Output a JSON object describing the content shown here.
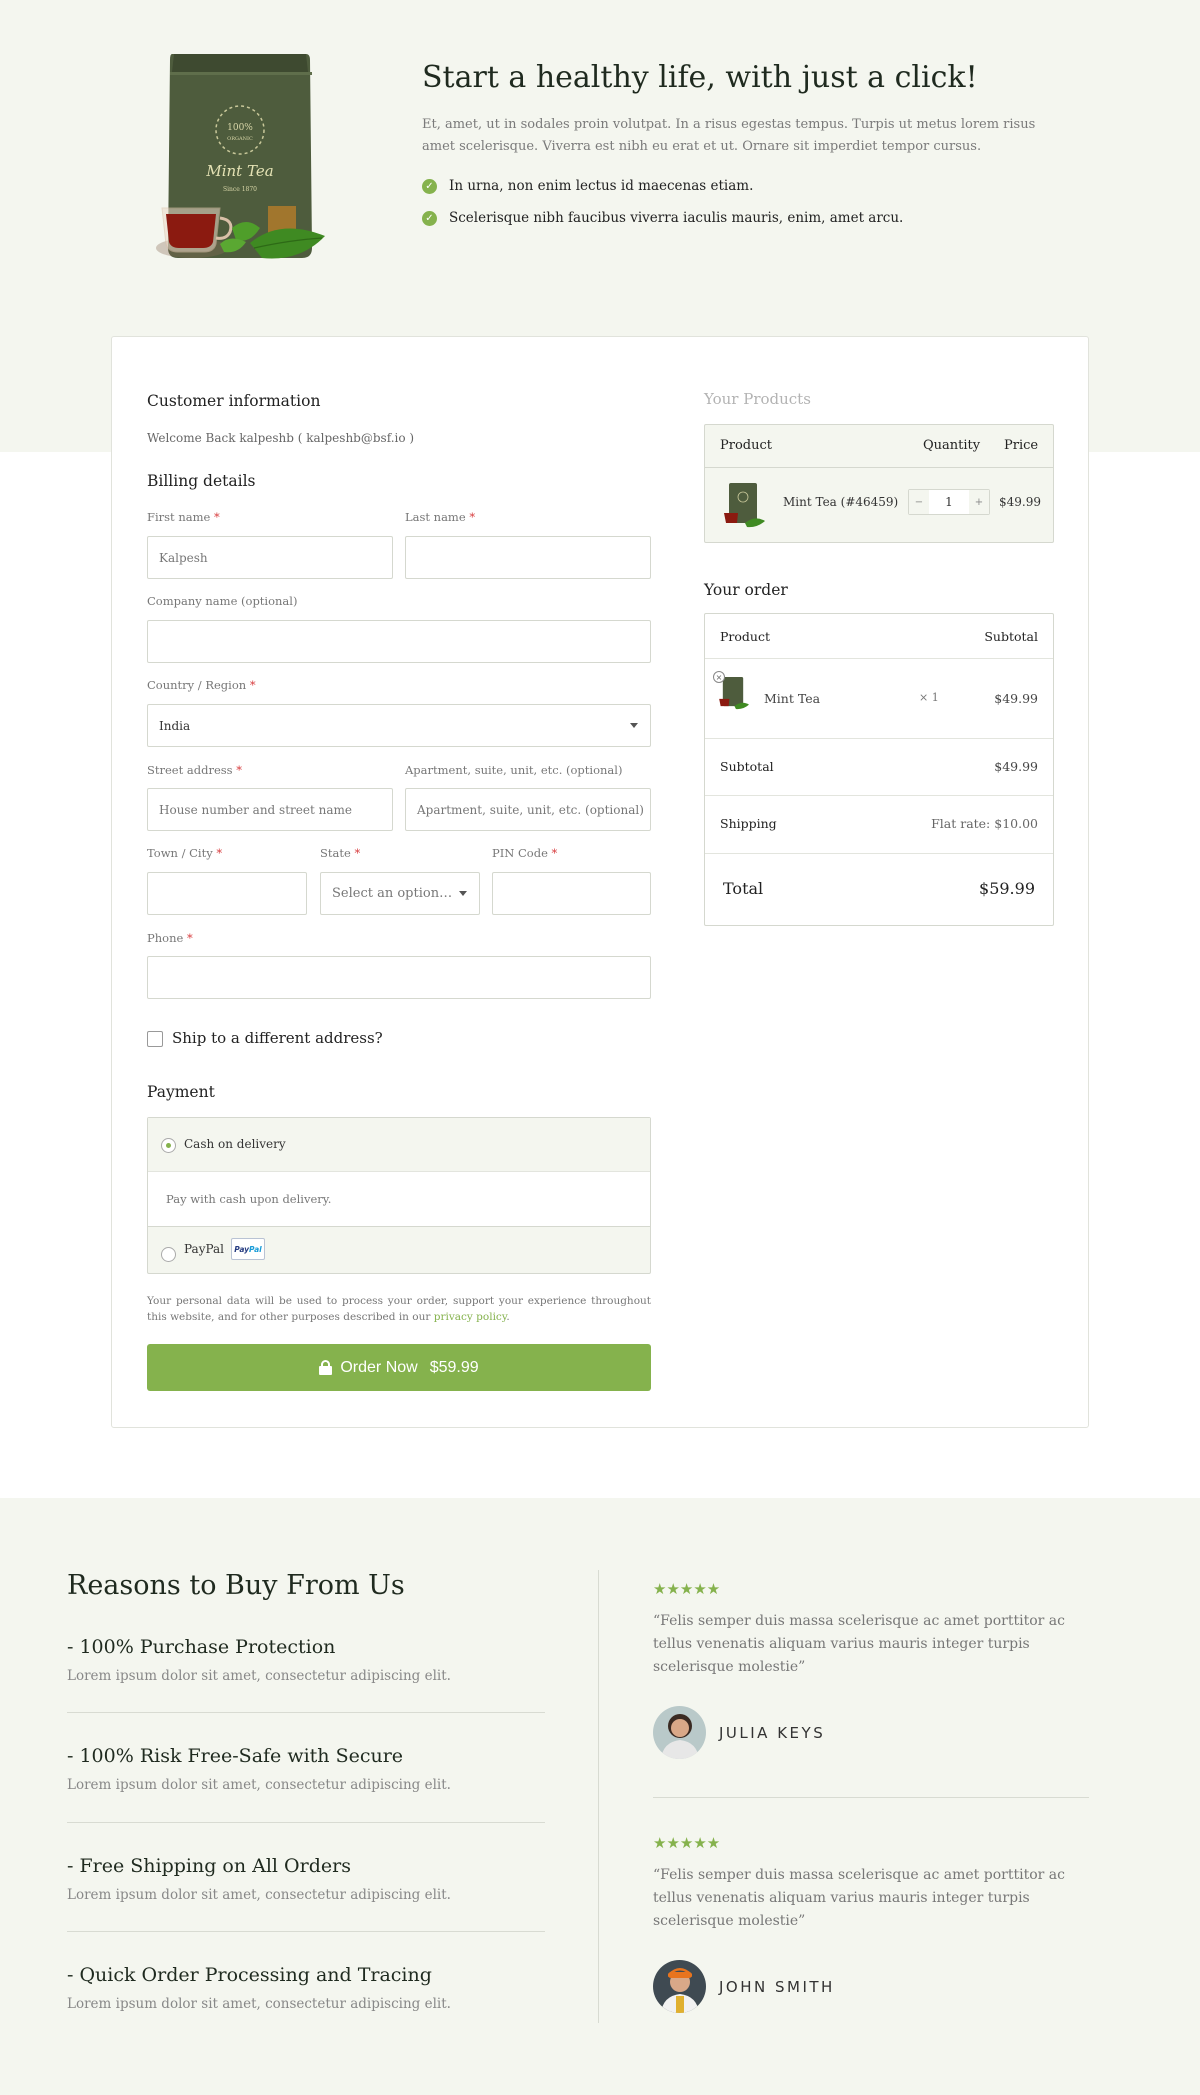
{
  "hero": {
    "title": "Start a healthy life, with just a click!",
    "description": "Et, amet, ut in sodales proin volutpat. In a risus egestas tempus. Turpis ut metus lorem risus amet scelerisque. Viverra est nibh eu erat et ut. Ornare sit imperdiet tempor cursus.",
    "bullets": [
      "In urna, non enim lectus id maecenas etiam.",
      "Scelerisque nibh faucibus viverra iaculis mauris, enim, amet arcu."
    ],
    "package": {
      "badge": "100%",
      "badge_sub": "ORGANIC",
      "name": "Mint Tea",
      "since": "Since 1870"
    }
  },
  "checkout": {
    "customer_info_title": "Customer information",
    "welcome": "Welcome Back kalpeshb ( kalpeshb@bsf.io )",
    "billing_title": "Billing details",
    "required_mark": "*",
    "fields": {
      "first_name": {
        "label": "First name",
        "value": "Kalpesh"
      },
      "last_name": {
        "label": "Last name",
        "value": ""
      },
      "company": {
        "label": "Company name (optional)",
        "value": ""
      },
      "country": {
        "label": "Country / Region",
        "value": "India"
      },
      "street": {
        "label": "Street address",
        "placeholder": "House number and street name"
      },
      "apartment": {
        "label": "Apartment, suite, unit, etc. (optional)",
        "placeholder": "Apartment, suite, unit, etc. (optional)"
      },
      "town": {
        "label": "Town / City",
        "value": ""
      },
      "state": {
        "label": "State",
        "placeholder": "Select an option…"
      },
      "pin": {
        "label": "PIN Code",
        "value": ""
      },
      "phone": {
        "label": "Phone",
        "value": ""
      }
    },
    "ship_different": "Ship to a different address?",
    "payment_title": "Payment",
    "payment_methods": [
      {
        "label": "Cash on delivery",
        "selected": true,
        "description": "Pay with cash upon delivery."
      },
      {
        "label": "PayPal",
        "selected": false
      }
    ],
    "paypal_badge": {
      "pay": "Pay",
      "pal": "Pal"
    },
    "privacy_text": "Your personal data will be used to process your order, support your experience throughout this website, and for other purposes described in our",
    "privacy_link": "privacy policy",
    "privacy_end": ".",
    "order_button_label": "Order Now",
    "order_button_amount": "$59.99"
  },
  "your_products": {
    "title": "Your Products",
    "headers": {
      "product": "Product",
      "quantity": "Quantity",
      "price": "Price"
    },
    "item": {
      "name": "Mint Tea (#46459)",
      "quantity": "1",
      "price": "$49.99",
      "minus": "−",
      "plus": "+"
    }
  },
  "your_order": {
    "title": "Your order",
    "headers": {
      "product": "Product",
      "subtotal": "Subtotal"
    },
    "item": {
      "name": "Mint Tea",
      "qty": "× 1",
      "price": "$49.99",
      "remove": "×"
    },
    "subtotal_label": "Subtotal",
    "subtotal_value": "$49.99",
    "shipping_label": "Shipping",
    "shipping_value": "Flat rate: $10.00",
    "total_label": "Total",
    "total_value": "$59.99"
  },
  "reasons": {
    "title": "Reasons to Buy From Us",
    "items": [
      {
        "title": "- 100% Purchase Protection",
        "text": "Lorem ipsum dolor sit amet, consectetur adipiscing elit."
      },
      {
        "title": "- 100% Risk Free-Safe with Secure",
        "text": "Lorem ipsum dolor sit amet, consectetur adipiscing elit."
      },
      {
        "title": "- Free Shipping on All Orders",
        "text": "Lorem ipsum dolor sit amet, consectetur adipiscing elit."
      },
      {
        "title": "- Quick Order Processing and Tracing",
        "text": "Lorem ipsum dolor sit amet, consectetur adipiscing elit."
      }
    ]
  },
  "testimonials": [
    {
      "stars": "★★★★★",
      "rating": 4.5,
      "quote": "“Felis semper duis massa scelerisque ac amet porttitor ac tellus venenatis aliquam varius mauris integer turpis scelerisque molestie”",
      "name": "JULIA KEYS"
    },
    {
      "stars": "★★★★★",
      "rating": 5,
      "quote": "“Felis semper duis massa scelerisque ac amet porttitor ac tellus venenatis aliquam varius mauris integer turpis scelerisque molestie”",
      "name": "JOHN SMITH"
    }
  ],
  "colors": {
    "accent": "#85b24d",
    "bg_soft": "#f4f6ef",
    "required": "#d63638"
  }
}
